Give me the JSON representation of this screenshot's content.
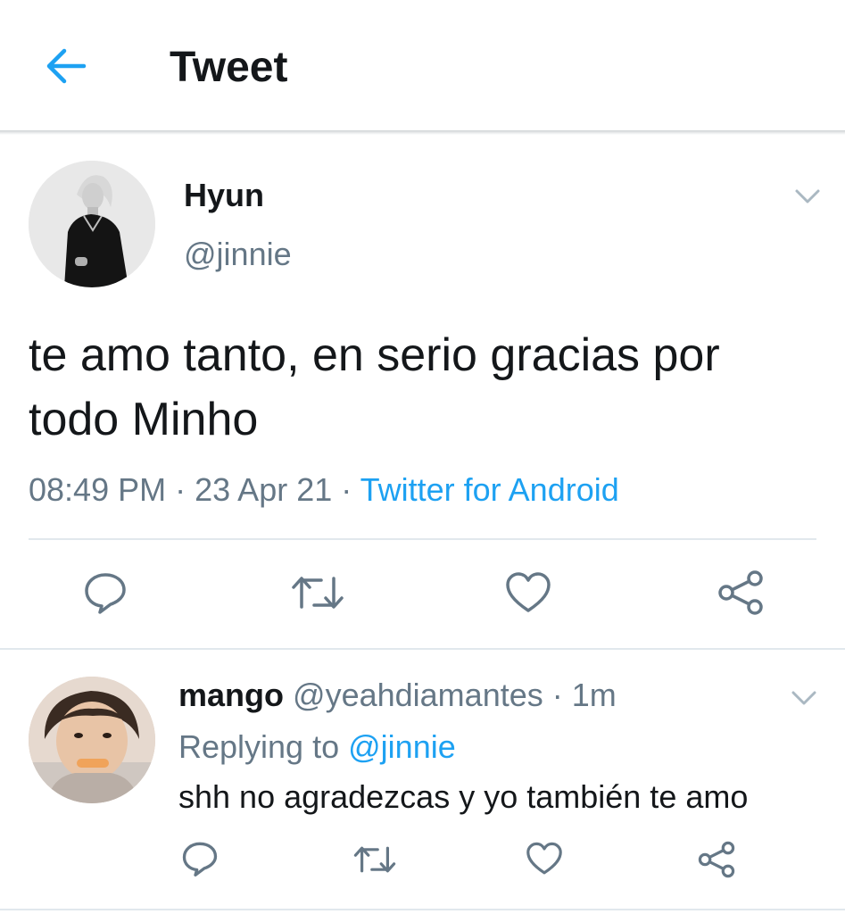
{
  "header": {
    "title": "Tweet",
    "back_icon": "arrow-left-icon",
    "accent": "#1da1f2"
  },
  "tweet": {
    "author_name": "Hyun",
    "author_handle": "@jinnie",
    "text": "te amo tanto, en serio gracias por todo Minho",
    "time": "08:49 PM",
    "date": "23 Apr 21",
    "source": "Twitter for Android",
    "separator": "·",
    "actions": [
      "reply-icon",
      "retweet-icon",
      "like-icon",
      "share-icon"
    ]
  },
  "reply": {
    "author_name": "mango",
    "author_handle": "@yeahdiamantes",
    "time": "1m",
    "separator": "·",
    "replying_prefix": "Replying to",
    "replying_to": "@jinnie",
    "text": "shh no agradezcas y yo también te amo",
    "actions": [
      "reply-icon",
      "retweet-icon",
      "like-icon",
      "share-icon"
    ]
  },
  "colors": {
    "text": "#14171a",
    "muted": "#657786",
    "link": "#1da1f2",
    "divider": "#e1e8ed"
  }
}
